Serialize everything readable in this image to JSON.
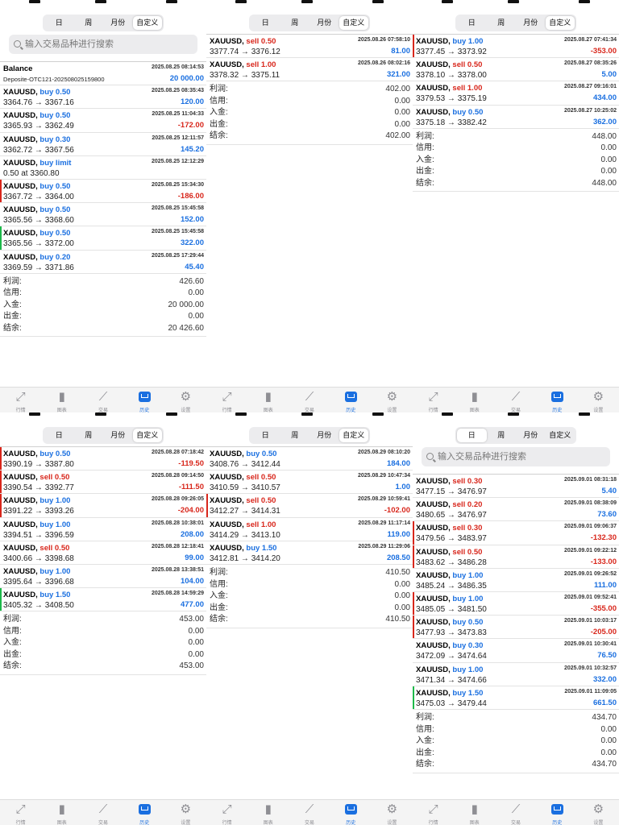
{
  "segments": [
    "日",
    "周",
    "月份",
    "自定义"
  ],
  "search_placeholder": "输入交易品种进行搜索",
  "tabs": [
    "行情",
    "图表",
    "交易",
    "历史",
    "设置"
  ],
  "summary_labels": [
    "利润:",
    "信用:",
    "入金:",
    "出金:",
    "结余:"
  ],
  "colors": {
    "buy": "#1a6fe0",
    "sell": "#d8261b",
    "accent": "#1a6fe0"
  },
  "panels": [
    {
      "active_segment": 3,
      "has_search": true,
      "rows": [
        {
          "kind": "balance",
          "title": "Balance",
          "sub": "Deposite-OTC121-202508025159800",
          "time": "2025.08.25 08:14:53",
          "value": "20 000.00",
          "sign": "pos"
        },
        {
          "sym": "XAUUSD,",
          "side": "buy 0.50",
          "dir": "buy",
          "prices": "3364.76 → 3367.16",
          "time": "2025.08.25 08:35:43",
          "value": "120.00",
          "sign": "pos"
        },
        {
          "sym": "XAUUSD,",
          "side": "buy 0.50",
          "dir": "buy",
          "prices": "3365.93 → 3362.49",
          "time": "2025.08.25 11:04:33",
          "value": "-172.00",
          "sign": "neg"
        },
        {
          "sym": "XAUUSD,",
          "side": "buy 0.30",
          "dir": "buy",
          "prices": "3362.72 → 3367.56",
          "time": "2025.08.25 12:11:57",
          "value": "145.20",
          "sign": "pos"
        },
        {
          "sym": "XAUUSD,",
          "side": "buy limit",
          "dir": "buy",
          "prices": "0.50 at 3360.80",
          "time": "2025.08.25 12:12:29",
          "value": "",
          "sign": "pos"
        },
        {
          "sym": "XAUUSD,",
          "side": "buy 0.50",
          "dir": "buy",
          "prices": "3367.72 → 3364.00",
          "time": "2025.08.25 15:34:30",
          "value": "-186.00",
          "sign": "neg",
          "mark": "red"
        },
        {
          "sym": "XAUUSD,",
          "side": "buy 0.50",
          "dir": "buy",
          "prices": "3365.56 → 3368.60",
          "time": "2025.08.25 15:45:58",
          "value": "152.00",
          "sign": "pos"
        },
        {
          "sym": "XAUUSD,",
          "side": "buy 0.50",
          "dir": "buy",
          "prices": "3365.56 → 3372.00",
          "time": "2025.08.25 15:45:58",
          "value": "322.00",
          "sign": "pos",
          "mark": "green"
        },
        {
          "sym": "XAUUSD,",
          "side": "buy 0.20",
          "dir": "buy",
          "prices": "3369.59 → 3371.86",
          "time": "2025.08.25 17:29:44",
          "value": "45.40",
          "sign": "pos"
        }
      ],
      "summary": [
        "426.60",
        "0.00",
        "20 000.00",
        "0.00",
        "20 426.60"
      ]
    },
    {
      "active_segment": 3,
      "has_search": false,
      "rows": [
        {
          "sym": "XAUUSD,",
          "side": "sell 0.50",
          "dir": "sell",
          "prices": "3377.74 → 3376.12",
          "time": "2025.08.26 07:58:10",
          "value": "81.00",
          "sign": "pos"
        },
        {
          "sym": "XAUUSD,",
          "side": "sell 1.00",
          "dir": "sell",
          "prices": "3378.32 → 3375.11",
          "time": "2025.08.26 08:02:16",
          "value": "321.00",
          "sign": "pos"
        }
      ],
      "summary": [
        "402.00",
        "0.00",
        "0.00",
        "0.00",
        "402.00"
      ]
    },
    {
      "active_segment": 3,
      "has_search": false,
      "rows": [
        {
          "sym": "XAUUSD,",
          "side": "buy 1.00",
          "dir": "buy",
          "prices": "3377.45 → 3373.92",
          "time": "2025.08.27 07:41:34",
          "value": "-353.00",
          "sign": "neg",
          "mark": "red"
        },
        {
          "sym": "XAUUSD,",
          "side": "sell 0.50",
          "dir": "sell",
          "prices": "3378.10 → 3378.00",
          "time": "2025.08.27 08:35:26",
          "value": "5.00",
          "sign": "pos"
        },
        {
          "sym": "XAUUSD,",
          "side": "sell 1.00",
          "dir": "sell",
          "prices": "3379.53 → 3375.19",
          "time": "2025.08.27 09:16:01",
          "value": "434.00",
          "sign": "pos"
        },
        {
          "sym": "XAUUSD,",
          "side": "buy 0.50",
          "dir": "buy",
          "prices": "3375.18 → 3382.42",
          "time": "2025.08.27 10:25:02",
          "value": "362.00",
          "sign": "pos"
        }
      ],
      "summary": [
        "448.00",
        "0.00",
        "0.00",
        "0.00",
        "448.00"
      ]
    },
    {
      "active_segment": 3,
      "has_search": false,
      "rows": [
        {
          "sym": "XAUUSD,",
          "side": "buy 0.50",
          "dir": "buy",
          "prices": "3390.19 → 3387.80",
          "time": "2025.08.28 07:18:42",
          "value": "-119.50",
          "sign": "neg",
          "mark": "red"
        },
        {
          "sym": "XAUUSD,",
          "side": "sell 0.50",
          "dir": "sell",
          "prices": "3390.54 → 3392.77",
          "time": "2025.08.28 09:14:50",
          "value": "-111.50",
          "sign": "neg",
          "mark": "red"
        },
        {
          "sym": "XAUUSD,",
          "side": "buy 1.00",
          "dir": "buy",
          "prices": "3391.22 → 3393.26",
          "time": "2025.08.28 09:26:05",
          "value": "-204.00",
          "sign": "neg",
          "mark": "red"
        },
        {
          "sym": "XAUUSD,",
          "side": "buy 1.00",
          "dir": "buy",
          "prices": "3394.51 → 3396.59",
          "time": "2025.08.28 10:38:01",
          "value": "208.00",
          "sign": "pos"
        },
        {
          "sym": "XAUUSD,",
          "side": "sell 0.50",
          "dir": "sell",
          "prices": "3400.66 → 3398.68",
          "time": "2025.08.28 12:18:41",
          "value": "99.00",
          "sign": "pos"
        },
        {
          "sym": "XAUUSD,",
          "side": "buy 1.00",
          "dir": "buy",
          "prices": "3395.64 → 3396.68",
          "time": "2025.08.28 13:38:51",
          "value": "104.00",
          "sign": "pos"
        },
        {
          "sym": "XAUUSD,",
          "side": "buy 1.50",
          "dir": "buy",
          "prices": "3405.32 → 3408.50",
          "time": "2025.08.28 14:59:29",
          "value": "477.00",
          "sign": "pos",
          "mark": "green"
        }
      ],
      "summary": [
        "453.00",
        "0.00",
        "0.00",
        "0.00",
        "453.00"
      ]
    },
    {
      "active_segment": 3,
      "has_search": false,
      "rows": [
        {
          "sym": "XAUUSD,",
          "side": "buy 0.50",
          "dir": "buy",
          "prices": "3408.76 → 3412.44",
          "time": "2025.08.29 08:10:20",
          "value": "184.00",
          "sign": "pos"
        },
        {
          "sym": "XAUUSD,",
          "side": "sell 0.50",
          "dir": "sell",
          "prices": "3410.59 → 3410.57",
          "time": "2025.08.29 10:47:34",
          "value": "1.00",
          "sign": "pos"
        },
        {
          "sym": "XAUUSD,",
          "side": "sell 0.50",
          "dir": "sell",
          "prices": "3412.27 → 3414.31",
          "time": "2025.08.29 10:59:41",
          "value": "-102.00",
          "sign": "neg",
          "mark": "red"
        },
        {
          "sym": "XAUUSD,",
          "side": "sell 1.00",
          "dir": "sell",
          "prices": "3414.29 → 3413.10",
          "time": "2025.08.29 11:17:14",
          "value": "119.00",
          "sign": "pos"
        },
        {
          "sym": "XAUUSD,",
          "side": "buy 1.50",
          "dir": "buy",
          "prices": "3412.81 → 3414.20",
          "time": "2025.08.29 11:29:06",
          "value": "208.50",
          "sign": "pos"
        }
      ],
      "summary": [
        "410.50",
        "0.00",
        "0.00",
        "0.00",
        "410.50"
      ]
    },
    {
      "active_segment": 0,
      "has_search": true,
      "rows": [
        {
          "sym": "XAUUSD,",
          "side": "sell 0.30",
          "dir": "sell",
          "prices": "3477.15 → 3476.97",
          "time": "2025.09.01 08:31:18",
          "value": "5.40",
          "sign": "pos"
        },
        {
          "sym": "XAUUSD,",
          "side": "sell 0.20",
          "dir": "sell",
          "prices": "3480.65 → 3476.97",
          "time": "2025.09.01 08:38:09",
          "value": "73.60",
          "sign": "pos"
        },
        {
          "sym": "XAUUSD,",
          "side": "sell 0.30",
          "dir": "sell",
          "prices": "3479.56 → 3483.97",
          "time": "2025.09.01 09:06:37",
          "value": "-132.30",
          "sign": "neg",
          "mark": "red"
        },
        {
          "sym": "XAUUSD,",
          "side": "sell 0.50",
          "dir": "sell",
          "prices": "3483.62 → 3486.28",
          "time": "2025.09.01 09:22:12",
          "value": "-133.00",
          "sign": "neg",
          "mark": "red"
        },
        {
          "sym": "XAUUSD,",
          "side": "buy 1.00",
          "dir": "buy",
          "prices": "3485.24 → 3486.35",
          "time": "2025.09.01 09:26:52",
          "value": "111.00",
          "sign": "pos"
        },
        {
          "sym": "XAUUSD,",
          "side": "buy 1.00",
          "dir": "buy",
          "prices": "3485.05 → 3481.50",
          "time": "2025.09.01 09:52:41",
          "value": "-355.00",
          "sign": "neg",
          "mark": "red"
        },
        {
          "sym": "XAUUSD,",
          "side": "buy 0.50",
          "dir": "buy",
          "prices": "3477.93 → 3473.83",
          "time": "2025.09.01 10:03:17",
          "value": "-205.00",
          "sign": "neg",
          "mark": "red"
        },
        {
          "sym": "XAUUSD,",
          "side": "buy 0.30",
          "dir": "buy",
          "prices": "3472.09 → 3474.64",
          "time": "2025.09.01 10:30:41",
          "value": "76.50",
          "sign": "pos"
        },
        {
          "sym": "XAUUSD,",
          "side": "buy 1.00",
          "dir": "buy",
          "prices": "3471.34 → 3474.66",
          "time": "2025.09.01 10:32:57",
          "value": "332.00",
          "sign": "pos"
        },
        {
          "sym": "XAUUSD,",
          "side": "buy 1.50",
          "dir": "buy",
          "prices": "3475.03 → 3479.44",
          "time": "2025.09.01 11:09:05",
          "value": "661.50",
          "sign": "pos",
          "mark": "green"
        }
      ],
      "summary": [
        "434.70",
        "0.00",
        "0.00",
        "0.00",
        "434.70"
      ]
    }
  ]
}
